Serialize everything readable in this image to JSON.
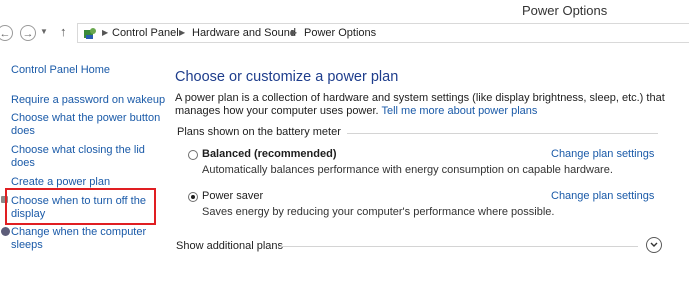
{
  "window": {
    "title": "Power Options"
  },
  "address_bar": {
    "back_icon": "back-arrow-icon",
    "forward_icon": "forward-arrow-icon",
    "up_icon": "up-arrow-icon",
    "location_icon": "control-panel-icon",
    "breadcrumbs": [
      "Control Panel",
      "Hardware and Sound",
      "Power Options"
    ]
  },
  "sidebar": {
    "home": "Control Panel Home",
    "items": [
      {
        "label_line1": "Require a password on wakeup",
        "label_line2": ""
      },
      {
        "label_line1": "Choose what the power button",
        "label_line2": "does"
      },
      {
        "label_line1": "Choose what closing the lid",
        "label_line2": "does"
      },
      {
        "label_line1": "Create a power plan",
        "label_line2": ""
      },
      {
        "label_line1": "Choose when to turn off the",
        "label_line2": "display"
      },
      {
        "label_line1": "Change when the computer",
        "label_line2": "sleeps"
      }
    ]
  },
  "main": {
    "title": "Choose or customize a power plan",
    "description": "A power plan is a collection of hardware and system settings (like display brightness, sleep, etc.) that manages how your computer uses power.",
    "description_link": "Tell me more about power plans",
    "section_label": "Plans shown on the battery meter",
    "plans": [
      {
        "name": "Balanced (recommended)",
        "selected": false,
        "description": "Automatically balances performance with energy consumption on capable hardware.",
        "change_link": "Change plan settings"
      },
      {
        "name": "Power saver",
        "selected": true,
        "description": "Saves energy by reducing your computer's performance where possible.",
        "change_link": "Change plan settings"
      }
    ],
    "show_additional": "Show additional plans",
    "expand_icon": "chevron-down-icon"
  },
  "colors": {
    "link": "#1a5aa8",
    "title": "#1e3d8c",
    "highlight": "#e01e22"
  }
}
